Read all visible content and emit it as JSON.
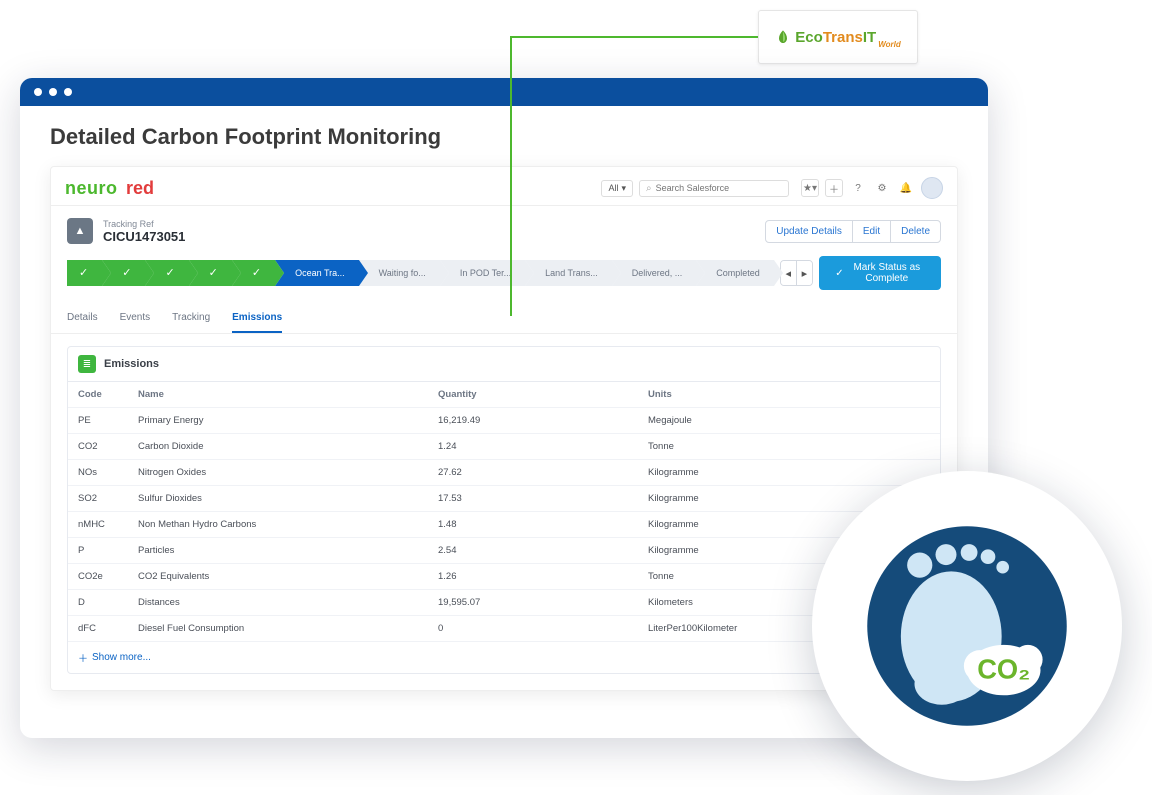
{
  "eco_logo": {
    "eco": "Eco",
    "trans": "Trans",
    "it": "IT",
    "world": "World"
  },
  "page_title": "Detailed Carbon Footprint Monitoring",
  "brand": {
    "neuro": "neuro",
    "red": "red"
  },
  "search": {
    "all_label": "All",
    "placeholder": "Search Salesforce"
  },
  "record": {
    "label": "Tracking Ref",
    "value": "CICU1473051",
    "actions": {
      "update": "Update Details",
      "edit": "Edit",
      "delete": "Delete"
    }
  },
  "status": {
    "done": [
      "",
      "",
      "",
      "",
      ""
    ],
    "current": "Ocean Tra...",
    "future": [
      "Waiting fo...",
      "In POD Ter...",
      "Land Trans...",
      "Delivered, ...",
      "Completed"
    ],
    "mark_complete": "Mark Status as Complete"
  },
  "tabs": [
    "Details",
    "Events",
    "Tracking",
    "Emissions"
  ],
  "active_tab": "Emissions",
  "emissions": {
    "title": "Emissions",
    "columns": {
      "code": "Code",
      "name": "Name",
      "quantity": "Quantity",
      "units": "Units"
    },
    "rows": [
      {
        "code": "PE",
        "name": "Primary Energy",
        "quantity": "16,219.49",
        "units": "Megajoule"
      },
      {
        "code": "CO2",
        "name": "Carbon Dioxide",
        "quantity": "1.24",
        "units": "Tonne"
      },
      {
        "code": "NOs",
        "name": "Nitrogen Oxides",
        "quantity": "27.62",
        "units": "Kilogramme"
      },
      {
        "code": "SO2",
        "name": "Sulfur Dioxides",
        "quantity": "17.53",
        "units": "Kilogramme"
      },
      {
        "code": "nMHC",
        "name": "Non Methan Hydro Carbons",
        "quantity": "1.48",
        "units": "Kilogramme"
      },
      {
        "code": "P",
        "name": "Particles",
        "quantity": "2.54",
        "units": "Kilogramme"
      },
      {
        "code": "CO2e",
        "name": "CO2 Equivalents",
        "quantity": "1.26",
        "units": "Tonne"
      },
      {
        "code": "D",
        "name": "Distances",
        "quantity": "19,595.07",
        "units": "Kilometers"
      },
      {
        "code": "dFC",
        "name": "Diesel Fuel Consumption",
        "quantity": "0",
        "units": "LiterPer100Kilometer"
      }
    ],
    "show_more": "Show more..."
  },
  "co2_badge": "CO₂"
}
